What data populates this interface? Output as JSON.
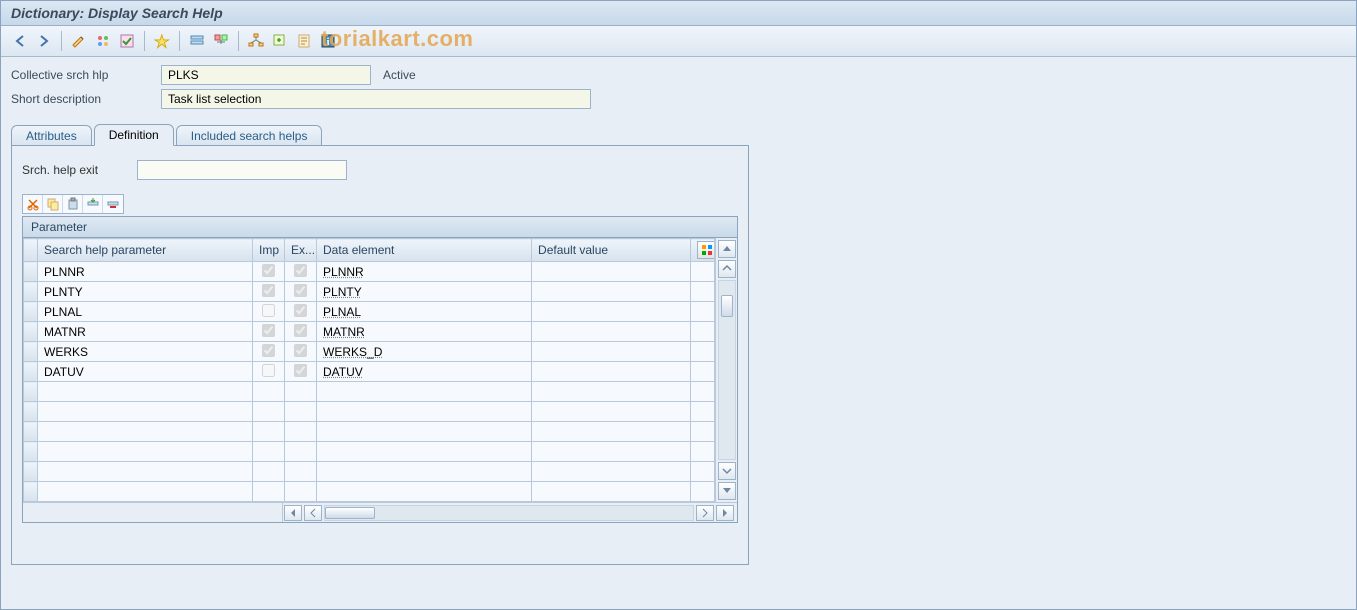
{
  "title": "Dictionary: Display Search Help",
  "watermark": "torialkart.com",
  "toolbar_icons": [
    "back",
    "forward",
    "sep",
    "pencil",
    "toggle",
    "activate",
    "sep",
    "where",
    "sep",
    "display-obj",
    "check",
    "sep",
    "hierarchy",
    "index",
    "glossary",
    "info"
  ],
  "form": {
    "name_label": "Collective srch hlp",
    "name_value": "PLKS",
    "status": "Active",
    "desc_label": "Short description",
    "desc_value": "Task list selection"
  },
  "tabs": {
    "t0": "Attributes",
    "t1": "Definition",
    "t2": "Included search helps",
    "active": 1
  },
  "panel": {
    "exit_label": "Srch. help exit",
    "exit_value": "",
    "grid_title": "Parameter",
    "columns": {
      "c0": "Search help parameter",
      "c1": "Imp",
      "c2": "Ex...",
      "c3": "Data element",
      "c4": "Default value"
    },
    "rows": [
      {
        "param": "PLNNR",
        "imp": true,
        "exp": true,
        "de": "PLNNR",
        "def": ""
      },
      {
        "param": "PLNTY",
        "imp": true,
        "exp": true,
        "de": "PLNTY",
        "def": ""
      },
      {
        "param": "PLNAL",
        "imp": false,
        "exp": true,
        "de": "PLNAL",
        "def": ""
      },
      {
        "param": "MATNR",
        "imp": true,
        "exp": true,
        "de": "MATNR",
        "def": ""
      },
      {
        "param": "WERKS",
        "imp": true,
        "exp": true,
        "de": "WERKS_D",
        "def": ""
      },
      {
        "param": "DATUV",
        "imp": false,
        "exp": true,
        "de": "DATUV",
        "def": ""
      }
    ],
    "empty_rows": 6
  }
}
